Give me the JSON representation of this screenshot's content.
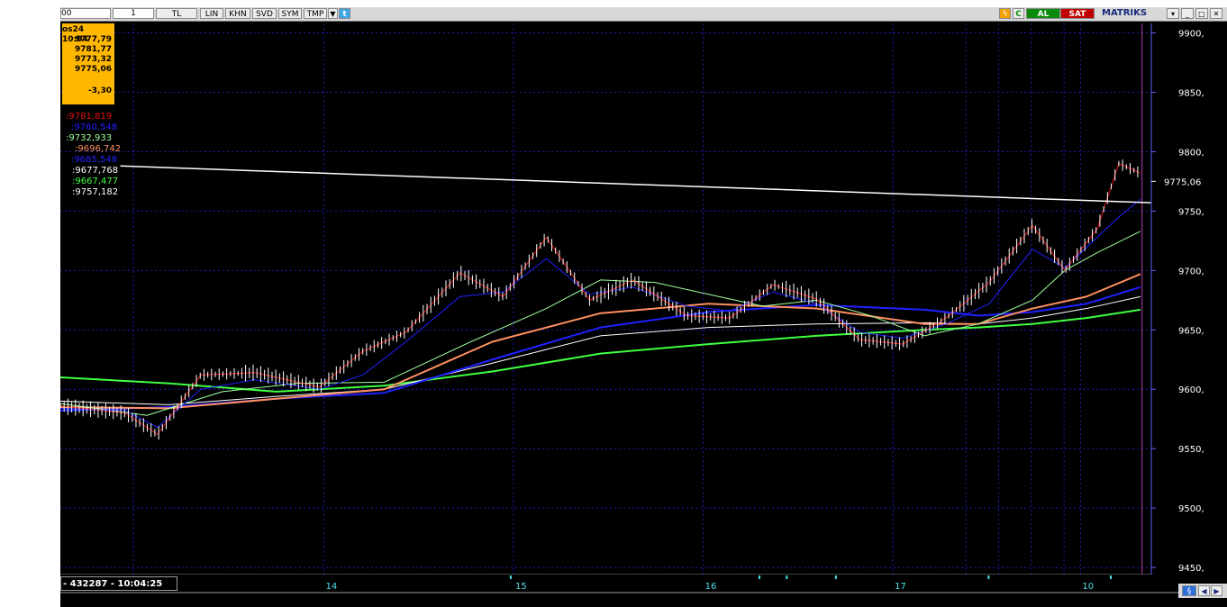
{
  "toolbar": {
    "symbol_box": "00",
    "period_box": "1",
    "buttons": [
      "TL",
      "LIN",
      "KHN",
      "SVD",
      "SYM",
      "TMP"
    ],
    "buy_label": "AL",
    "sell_label": "SAT",
    "brand": "MATRIKS"
  },
  "info": {
    "date_time": "os24 10:04",
    "open": "9777,79",
    "high": "9781,77",
    "low": "9773,32",
    "close": "9775,06",
    "change": "-3,30"
  },
  "ma_labels": [
    {
      "text": ":9781,819",
      "color": "#e01010"
    },
    {
      "text": ":9760,548",
      "color": "#2020ff"
    },
    {
      "text": ":9732,933",
      "color": "#a0ffa0"
    },
    {
      "text": ":9696,742",
      "color": "#ff9060"
    },
    {
      "text": ":9685,548",
      "color": "#2020ff"
    },
    {
      "text": ":9677,768",
      "color": "#ffffff"
    },
    {
      "text": ":9667,477",
      "color": "#40ff40"
    },
    {
      "text": ":9757,182",
      "color": "#ffffff"
    }
  ],
  "status": "- 432287 - 10:04:25",
  "chart_data": {
    "type": "line",
    "y_tick_labels": [
      "9900,",
      "9850,",
      "9800,",
      "9750,",
      "9700,",
      "9650,",
      "9600,",
      "9550,",
      "9500,",
      "9450,"
    ],
    "y_ticks": [
      9900,
      9850,
      9800,
      9750,
      9700,
      9650,
      9600,
      9550,
      9500,
      9450
    ],
    "ylim": [
      9444,
      9908
    ],
    "last_price_label": "9775,06",
    "last_price": 9775.06,
    "x_labels": [
      {
        "text": "14",
        "pos": 0.25
      },
      {
        "text": "15",
        "pos": 0.43
      },
      {
        "text": "16",
        "pos": 0.61
      },
      {
        "text": "17",
        "pos": 0.79
      },
      {
        "text": "10",
        "pos": 0.968
      }
    ],
    "trendline": {
      "start": [
        0.055,
        9788
      ],
      "end": [
        1.0,
        9757
      ]
    },
    "series": [
      {
        "color": "#40ff40",
        "width": 2,
        "x": [
          0,
          0.1,
          0.2,
          0.3,
          0.4,
          0.5,
          0.6,
          0.7,
          0.8,
          0.85,
          0.9,
          0.95,
          1.0
        ],
        "y": [
          9610,
          9605,
          9598,
          9603,
          9615,
          9630,
          9638,
          9645,
          9650,
          9652,
          9655,
          9660,
          9667
        ]
      },
      {
        "color": "#ffffff",
        "width": 1,
        "x": [
          0,
          0.1,
          0.2,
          0.3,
          0.4,
          0.5,
          0.6,
          0.7,
          0.8,
          0.85,
          0.9,
          0.95,
          1.0
        ],
        "y": [
          9590,
          9587,
          9594,
          9600,
          9622,
          9645,
          9652,
          9655,
          9656,
          9655,
          9660,
          9668,
          9678
        ]
      },
      {
        "color": "#2020ff",
        "width": 2,
        "x": [
          0,
          0.1,
          0.2,
          0.3,
          0.4,
          0.5,
          0.6,
          0.7,
          0.8,
          0.85,
          0.9,
          0.95,
          1.0
        ],
        "y": [
          9582,
          9585,
          9592,
          9597,
          9625,
          9652,
          9665,
          9671,
          9667,
          9662,
          9665,
          9672,
          9686
        ]
      },
      {
        "color": "#ff9060",
        "width": 2,
        "x": [
          0,
          0.1,
          0.2,
          0.3,
          0.4,
          0.5,
          0.6,
          0.7,
          0.8,
          0.85,
          0.9,
          0.95,
          1.0
        ],
        "y": [
          9585,
          9584,
          9592,
          9600,
          9640,
          9664,
          9672,
          9668,
          9655,
          9655,
          9668,
          9678,
          9697
        ]
      },
      {
        "color": "#a0ffa0",
        "width": 1,
        "x": [
          0,
          0.08,
          0.15,
          0.22,
          0.3,
          0.38,
          0.45,
          0.5,
          0.55,
          0.6,
          0.65,
          0.7,
          0.75,
          0.8,
          0.85,
          0.9,
          0.93,
          0.96,
          1.0
        ],
        "y": [
          9588,
          9578,
          9598,
          9605,
          9606,
          9640,
          9668,
          9692,
          9690,
          9680,
          9670,
          9675,
          9662,
          9645,
          9655,
          9675,
          9700,
          9715,
          9733
        ]
      },
      {
        "color": "#2020ff",
        "width": 1,
        "x": [
          0,
          0.06,
          0.09,
          0.13,
          0.18,
          0.24,
          0.28,
          0.32,
          0.37,
          0.41,
          0.45,
          0.49,
          0.53,
          0.58,
          0.62,
          0.66,
          0.7,
          0.74,
          0.78,
          0.82,
          0.86,
          0.9,
          0.93,
          0.96,
          0.98,
          1.0
        ],
        "y": [
          9584,
          9582,
          9568,
          9600,
          9608,
          9600,
          9612,
          9640,
          9678,
          9682,
          9710,
          9680,
          9686,
          9670,
          9666,
          9682,
          9672,
          9648,
          9643,
          9655,
          9672,
          9718,
          9702,
          9728,
          9745,
          9760
        ]
      },
      {
        "color": "#e01010",
        "width": 1,
        "x": [
          0,
          0.06,
          0.09,
          0.13,
          0.18,
          0.24,
          0.28,
          0.32,
          0.37,
          0.41,
          0.45,
          0.49,
          0.53,
          0.58,
          0.62,
          0.66,
          0.7,
          0.74,
          0.78,
          0.82,
          0.86,
          0.9,
          0.93,
          0.96,
          0.98,
          1.0
        ],
        "y": [
          9586,
          9580,
          9562,
          9612,
          9614,
          9602,
          9632,
          9648,
          9698,
          9678,
          9728,
          9675,
          9692,
          9662,
          9660,
          9688,
          9676,
          9642,
          9638,
          9660,
          9690,
          9738,
          9700,
          9735,
          9790,
          9782
        ]
      }
    ]
  }
}
